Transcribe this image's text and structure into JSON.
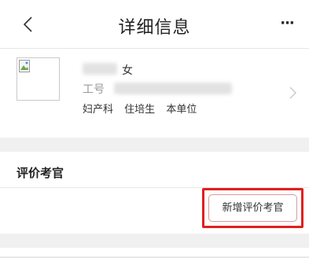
{
  "header": {
    "title": "详细信息",
    "back_icon": "chevron-left-icon",
    "more_icon": "more-horizontal-icon",
    "more_text": "···"
  },
  "profile": {
    "gender": "女",
    "id_label": "工号",
    "tags": [
      "妇产科",
      "住培生",
      "本单位"
    ],
    "arrow_icon": "chevron-right-icon"
  },
  "section": {
    "title": "评价考官",
    "add_button_label": "新增评价考官"
  },
  "colors": {
    "highlight": "#e02020",
    "background_gap": "#f0f0f0"
  }
}
